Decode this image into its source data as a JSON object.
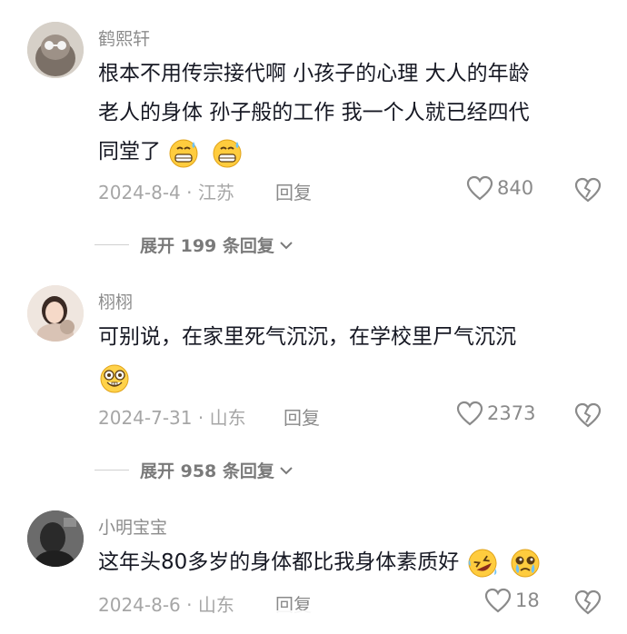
{
  "comments": [
    {
      "username": "鹤熙轩",
      "lines": [
        "根本不用传宗接代啊  小孩子的心理  大人的年龄",
        "老人的身体   孙子般的工作  我一个人就已经四代",
        "同堂了"
      ],
      "date_location": "2024-8-4 · 江苏",
      "reply_label": "回复",
      "likes": "840",
      "expand_label": "展开 199 条回复"
    },
    {
      "username": "栩栩",
      "lines": [
        "可别说，在家里死气沉沉，在学校里尸气沉沉"
      ],
      "date_location": "2024-7-31 · 山东",
      "reply_label": "回复",
      "likes": "2373",
      "expand_label": "展开 958 条回复"
    },
    {
      "username": "小明宝宝",
      "lines": [
        "这年头80多岁的身体都比我身体素质好"
      ],
      "date_location": "2024-8-6 · 山东",
      "reply_label": "回复",
      "likes": "18"
    }
  ],
  "colors": {
    "text": "#161823",
    "meta": "#a6a6a6",
    "username": "#8c8c8c"
  },
  "icons": [
    "heart-outline-icon",
    "broken-heart-icon",
    "chevron-down-icon",
    "grimacing-sweat-emoji",
    "nerd-grin-emoji",
    "rolling-laughing-emoji",
    "pleading-tears-emoji"
  ]
}
